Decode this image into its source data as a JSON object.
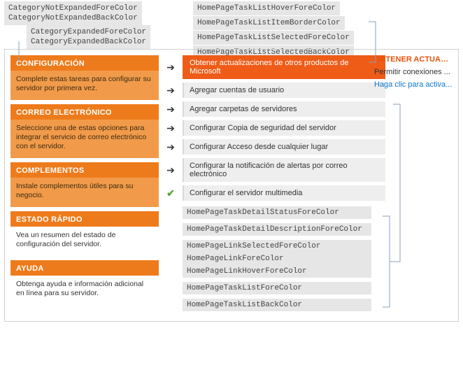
{
  "annotations": {
    "topLeft1_line1": "CategoryNotExpandedForeColor",
    "topLeft1_line2": "CategoryNotExpandedBackColor",
    "topLeft2_line1": "CategoryExpandedForeColor",
    "topLeft2_line2": "CategoryExpandedBackColor",
    "topRight_1": "HomePageTaskListHoverForeColor",
    "topRight_2": "HomePageTaskListItemBorderColor",
    "topRight_3": "HomePageTaskListSelectedForeColor",
    "topRight_4": "HomePageTaskListSelectedBackColor"
  },
  "sidebar": {
    "categories": [
      {
        "title": "CONFIGURACIÓN",
        "desc": "Complete estas tareas para configurar su servidor por primera vez."
      },
      {
        "title": "CORREO ELECTRÓNICO",
        "desc": "Seleccione una de estas opciones para integrar el servicio de correo electrónico con el servidor."
      },
      {
        "title": "COMPLEMENTOS",
        "desc": "Instale complementos útiles para su negocio."
      },
      {
        "title": "ESTADO RÁPIDO",
        "desc": "Vea un resumen del estado de configuración del servidor."
      },
      {
        "title": "AYUDA",
        "desc": "Obtenga ayuda e información adicional en línea para su servidor."
      }
    ]
  },
  "tasks": [
    {
      "label": "Obtener actualizaciones de otros productos de Microsoft",
      "selected": true,
      "icon": "arrow"
    },
    {
      "label": "Agregar cuentas de usuario",
      "selected": false,
      "icon": "arrow"
    },
    {
      "label": "Agregar carpetas de servidores",
      "selected": false,
      "icon": "arrow"
    },
    {
      "label": "Configurar Copia de seguridad del servidor",
      "selected": false,
      "icon": "arrow"
    },
    {
      "label": "Configurar Acceso desde cualquier lugar",
      "selected": false,
      "icon": "arrow"
    },
    {
      "label": "Configurar la notificación de alertas por correo electrónico",
      "selected": false,
      "icon": "arrow"
    },
    {
      "label": "Configurar el servidor multimedia",
      "selected": false,
      "icon": "check"
    }
  ],
  "detailLabels": {
    "d1": "HomePageTaskDetailStatusForeColor",
    "d2": "HomePageTaskDetailDescriptionForeColor",
    "d3a": "HomePageLinkSelectedForeColor",
    "d3b": "HomePageLinkForeColor",
    "d3c": "HomePageLinkHoverForeColor",
    "d4": "HomePageTaskListForeColor",
    "d5": "HomePageTaskListBackColor"
  },
  "sideLinks": {
    "l1": "OBTENER ACTUALIZ...",
    "l2": "Permitir conexiones ...",
    "l3": "Haga clic para activa..."
  }
}
